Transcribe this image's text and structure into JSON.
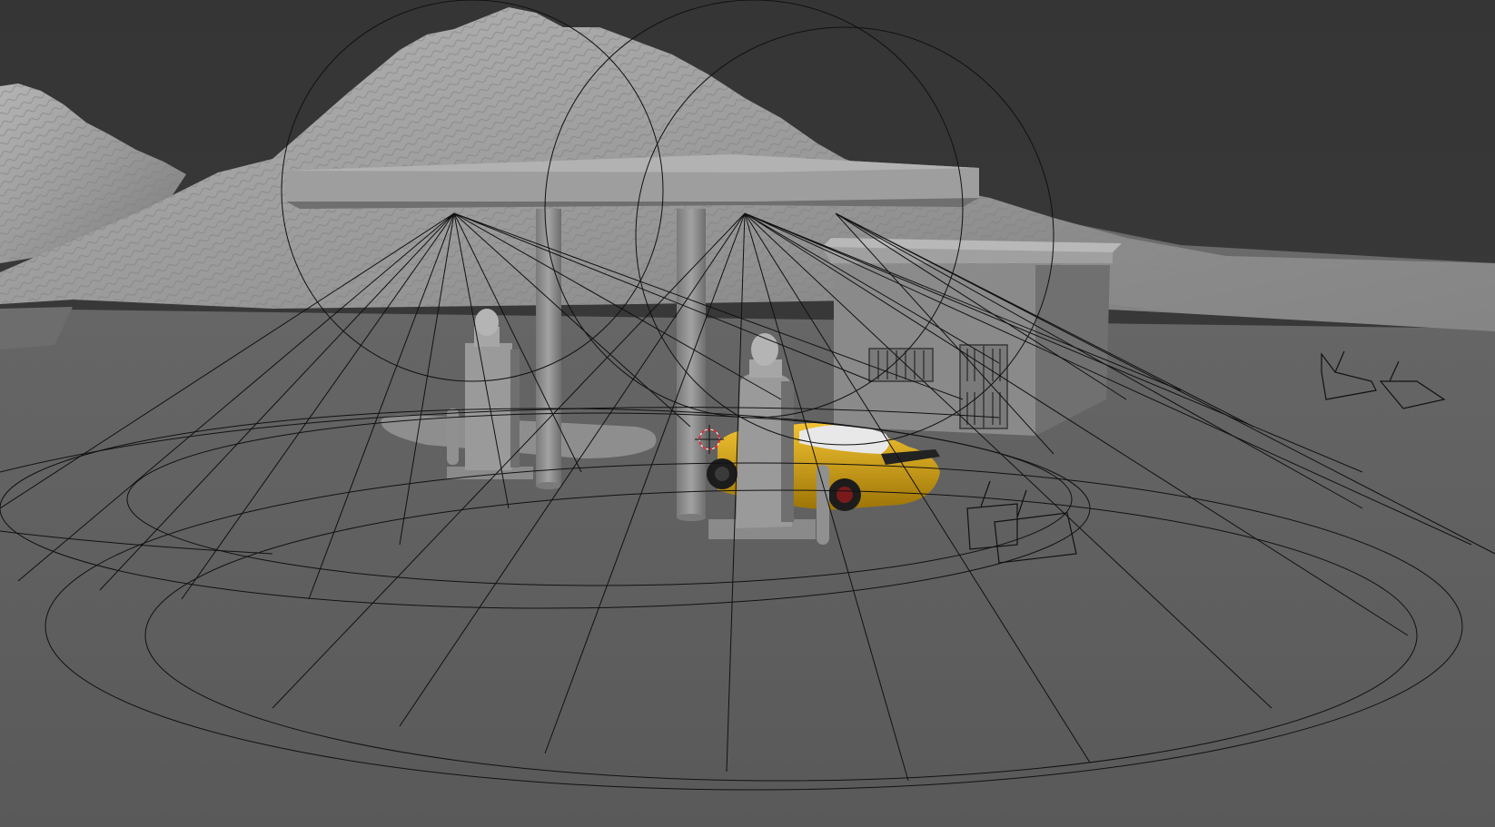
{
  "viewport": {
    "kind": "3D viewport (solid shading)",
    "background_color": "#3a3a3a",
    "ground_color": "#5e5e5e",
    "terrain_color": "#9a9a9a",
    "model_color": "#8c8c8c",
    "car_color": "#d9a514",
    "overlay_line_color": "#111111",
    "cursor_color": "#e03030"
  },
  "scene_objects": {
    "terrain": "mountains-mesh",
    "ground": "ground-plane",
    "canopy": "gas-station-canopy",
    "pillars": [
      "canopy-pillar-left",
      "canopy-pillar-right"
    ],
    "pumps": [
      "fuel-pump-left",
      "fuel-pump-right"
    ],
    "building": "station-building",
    "car": "sports-car",
    "lights": [
      "spot-light-left",
      "spot-light-right",
      "spot-light-building"
    ],
    "cameras": [
      "camera-1",
      "camera-2",
      "camera-3",
      "camera-4"
    ],
    "cursor": "3d-cursor"
  }
}
